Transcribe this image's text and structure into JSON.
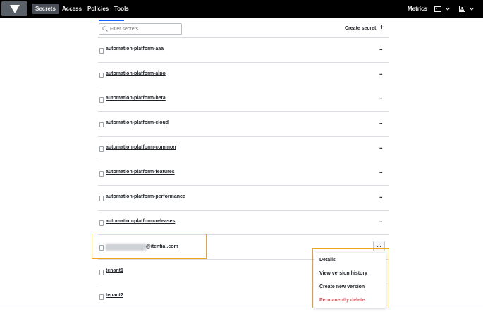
{
  "nav": {
    "items": [
      {
        "label": "Secrets",
        "active": true
      },
      {
        "label": "Access",
        "active": false
      },
      {
        "label": "Policies",
        "active": false
      },
      {
        "label": "Tools",
        "active": false
      }
    ],
    "metrics_label": "Metrics"
  },
  "toolbar": {
    "filter_placeholder": "Filter secrets",
    "create_label": "Create secret",
    "create_icon": "plus-icon"
  },
  "secrets": [
    {
      "name": "automation-platform-aaa"
    },
    {
      "name": "automation-platform-alpo"
    },
    {
      "name": "automation-platform-beta"
    },
    {
      "name": "automation-platform-cloud"
    },
    {
      "name": "automation-platform-common"
    },
    {
      "name": "automation-platform-features"
    },
    {
      "name": "automation-platform-performance"
    },
    {
      "name": "automation-platform-releases"
    },
    {
      "name": "@itential.com",
      "redacted_prefix": true
    },
    {
      "name": "tenant1"
    },
    {
      "name": "tenant2"
    }
  ],
  "row_menu_label": "...",
  "context_menu": {
    "items": [
      {
        "label": "Details"
      },
      {
        "label": "View version history"
      },
      {
        "label": "Create new version"
      },
      {
        "label": "Permanently delete",
        "danger": true
      }
    ]
  },
  "colors": {
    "topbar": "#000000",
    "active_tab_underline": "#1563ff",
    "highlight": "#f3a21b",
    "danger": "#e34d5a"
  }
}
